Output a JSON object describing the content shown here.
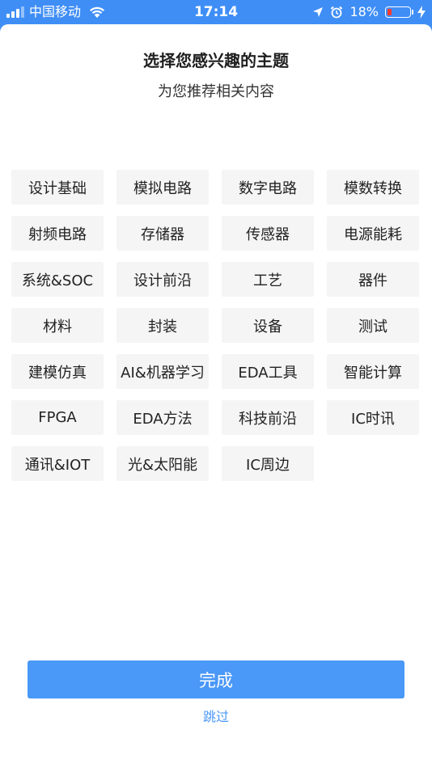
{
  "status_bar": {
    "carrier": "中国移动",
    "time": "17:14",
    "battery_percent": "18%",
    "battery_level": 0.18,
    "battery_color": "#ff3b30",
    "icons": [
      "signal-icon",
      "wifi-icon",
      "location-arrow-icon",
      "alarm-clock-icon",
      "battery-icon",
      "charging-bolt-icon"
    ]
  },
  "header": {
    "title": "选择您感兴趣的主题",
    "subtitle": "为您推荐相关内容"
  },
  "topics": [
    "设计基础",
    "模拟电路",
    "数字电路",
    "模数转换",
    "射频电路",
    "存储器",
    "传感器",
    "电源能耗",
    "系统&SOC",
    "设计前沿",
    "工艺",
    "器件",
    "材料",
    "封装",
    "设备",
    "测试",
    "建模仿真",
    "AI&机器学习",
    "EDA工具",
    "智能计算",
    "FPGA",
    "EDA方法",
    "科技前沿",
    "IC时讯",
    "通讯&IOT",
    "光&太阳能",
    "IC周边"
  ],
  "actions": {
    "done_label": "完成",
    "skip_label": "跳过"
  },
  "colors": {
    "accent": "#4a98f7",
    "status_bar_bg": "#3f8ef6",
    "tag_bg": "#f5f5f5"
  }
}
